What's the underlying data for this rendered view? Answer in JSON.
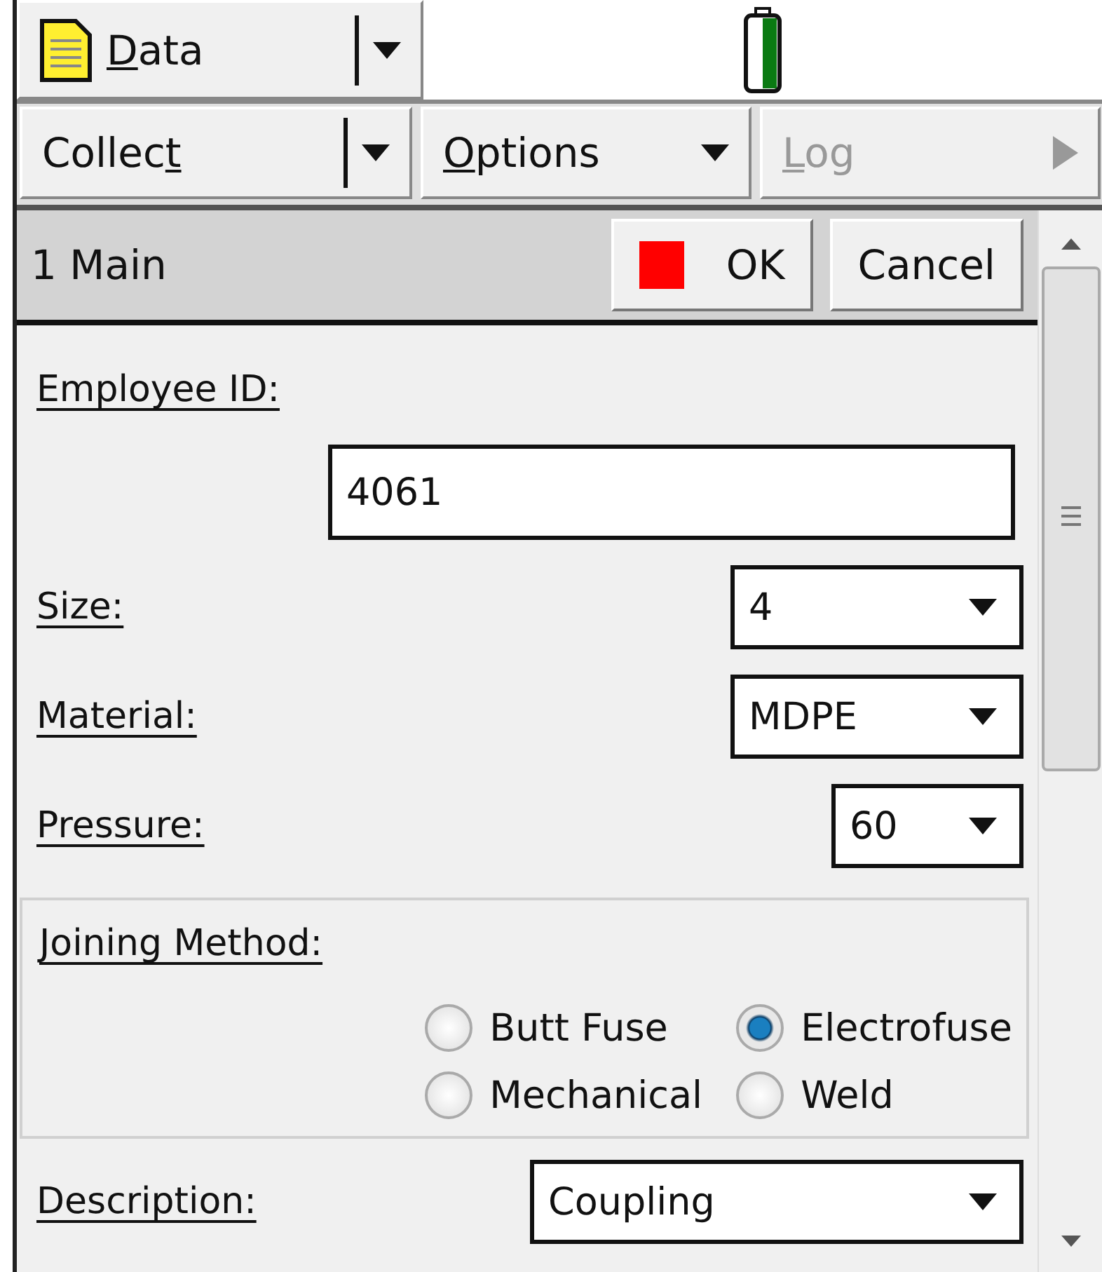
{
  "toolbar": {
    "data_button": {
      "key": "D",
      "post": "ata"
    }
  },
  "menu_buttons": [
    {
      "pre": "Collec",
      "key": "t",
      "kind": "split",
      "disabled": false
    },
    {
      "key": "O",
      "post": "ptions",
      "kind": "dropdown",
      "disabled": false
    },
    {
      "key": "L",
      "post": "og",
      "kind": "submenu",
      "disabled": true
    }
  ],
  "form_header": {
    "title": "1 Main",
    "ok": "OK",
    "cancel": "Cancel"
  },
  "fields": [
    {
      "kind": "text",
      "label": "Employee ID:",
      "value": "4061"
    },
    {
      "kind": "select",
      "label": "Size:",
      "value": "4"
    },
    {
      "kind": "select",
      "label": "Material:",
      "value": "MDPE"
    },
    {
      "kind": "smallselect",
      "label": "Pressure:",
      "value": "60"
    }
  ],
  "joining_method": {
    "label": "Joining Method:",
    "options": [
      {
        "label": "Butt Fuse",
        "selected": false
      },
      {
        "label": "Electrofuse",
        "selected": true
      },
      {
        "label": "Mechanical",
        "selected": false
      },
      {
        "label": "Weld",
        "selected": false
      }
    ]
  },
  "description": {
    "label": "Description:",
    "value": "Coupling"
  }
}
